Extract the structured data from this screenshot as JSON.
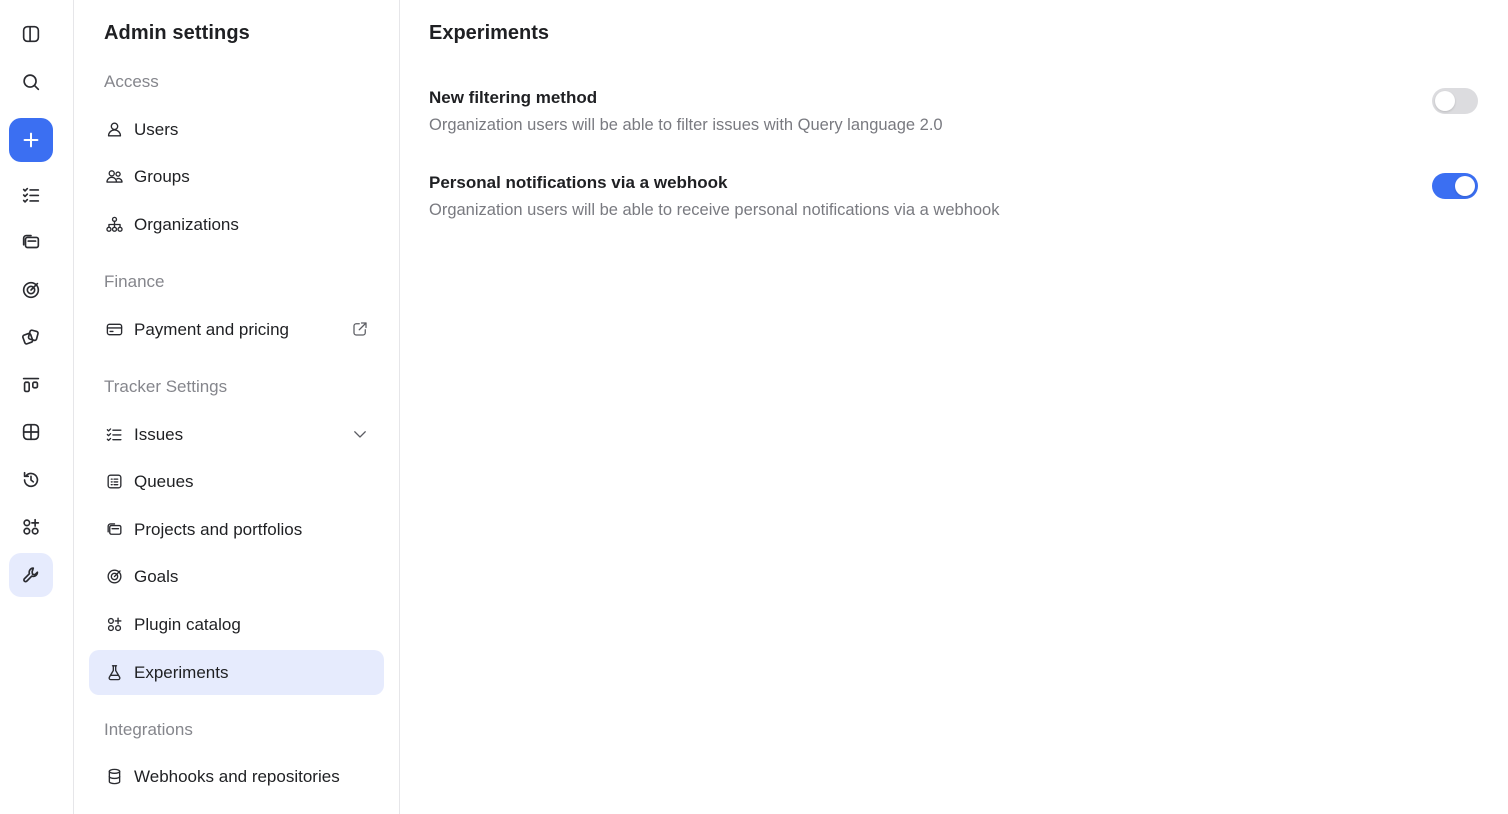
{
  "sidebar": {
    "title": "Admin settings",
    "sections": {
      "access": "Access",
      "finance": "Finance",
      "tracker": "Tracker Settings",
      "integrations": "Integrations"
    },
    "items": {
      "users": "Users",
      "groups": "Groups",
      "organizations": "Organizations",
      "payment": "Payment and pricing",
      "issues": "Issues",
      "queues": "Queues",
      "projects": "Projects and portfolios",
      "goals": "Goals",
      "plugins": "Plugin catalog",
      "experiments": "Experiments",
      "webhooks": "Webhooks and repositories"
    },
    "selected": "experiments"
  },
  "rail": {
    "icons": [
      "panel-toggle-icon",
      "search-icon",
      "create-plus-icon",
      "issues-list-icon",
      "projects-folder-icon",
      "goals-target-icon",
      "portfolio-icon",
      "boards-icon",
      "dashboards-grid-icon",
      "history-icon",
      "plugins-icon",
      "admin-wrench-icon"
    ],
    "active": "admin-wrench-icon"
  },
  "main": {
    "title": "Experiments",
    "experiments": [
      {
        "title": "New filtering method",
        "description": "Organization users will be able to filter issues with Query language 2.0",
        "enabled": false
      },
      {
        "title": "Personal notifications via a webhook",
        "description": "Organization users will be able to receive personal notifications via a webhook",
        "enabled": true
      }
    ]
  },
  "colors": {
    "accent": "#3b6ff2",
    "selected_bg": "#e6ebfd",
    "toggle_off": "#dcdcdf"
  }
}
